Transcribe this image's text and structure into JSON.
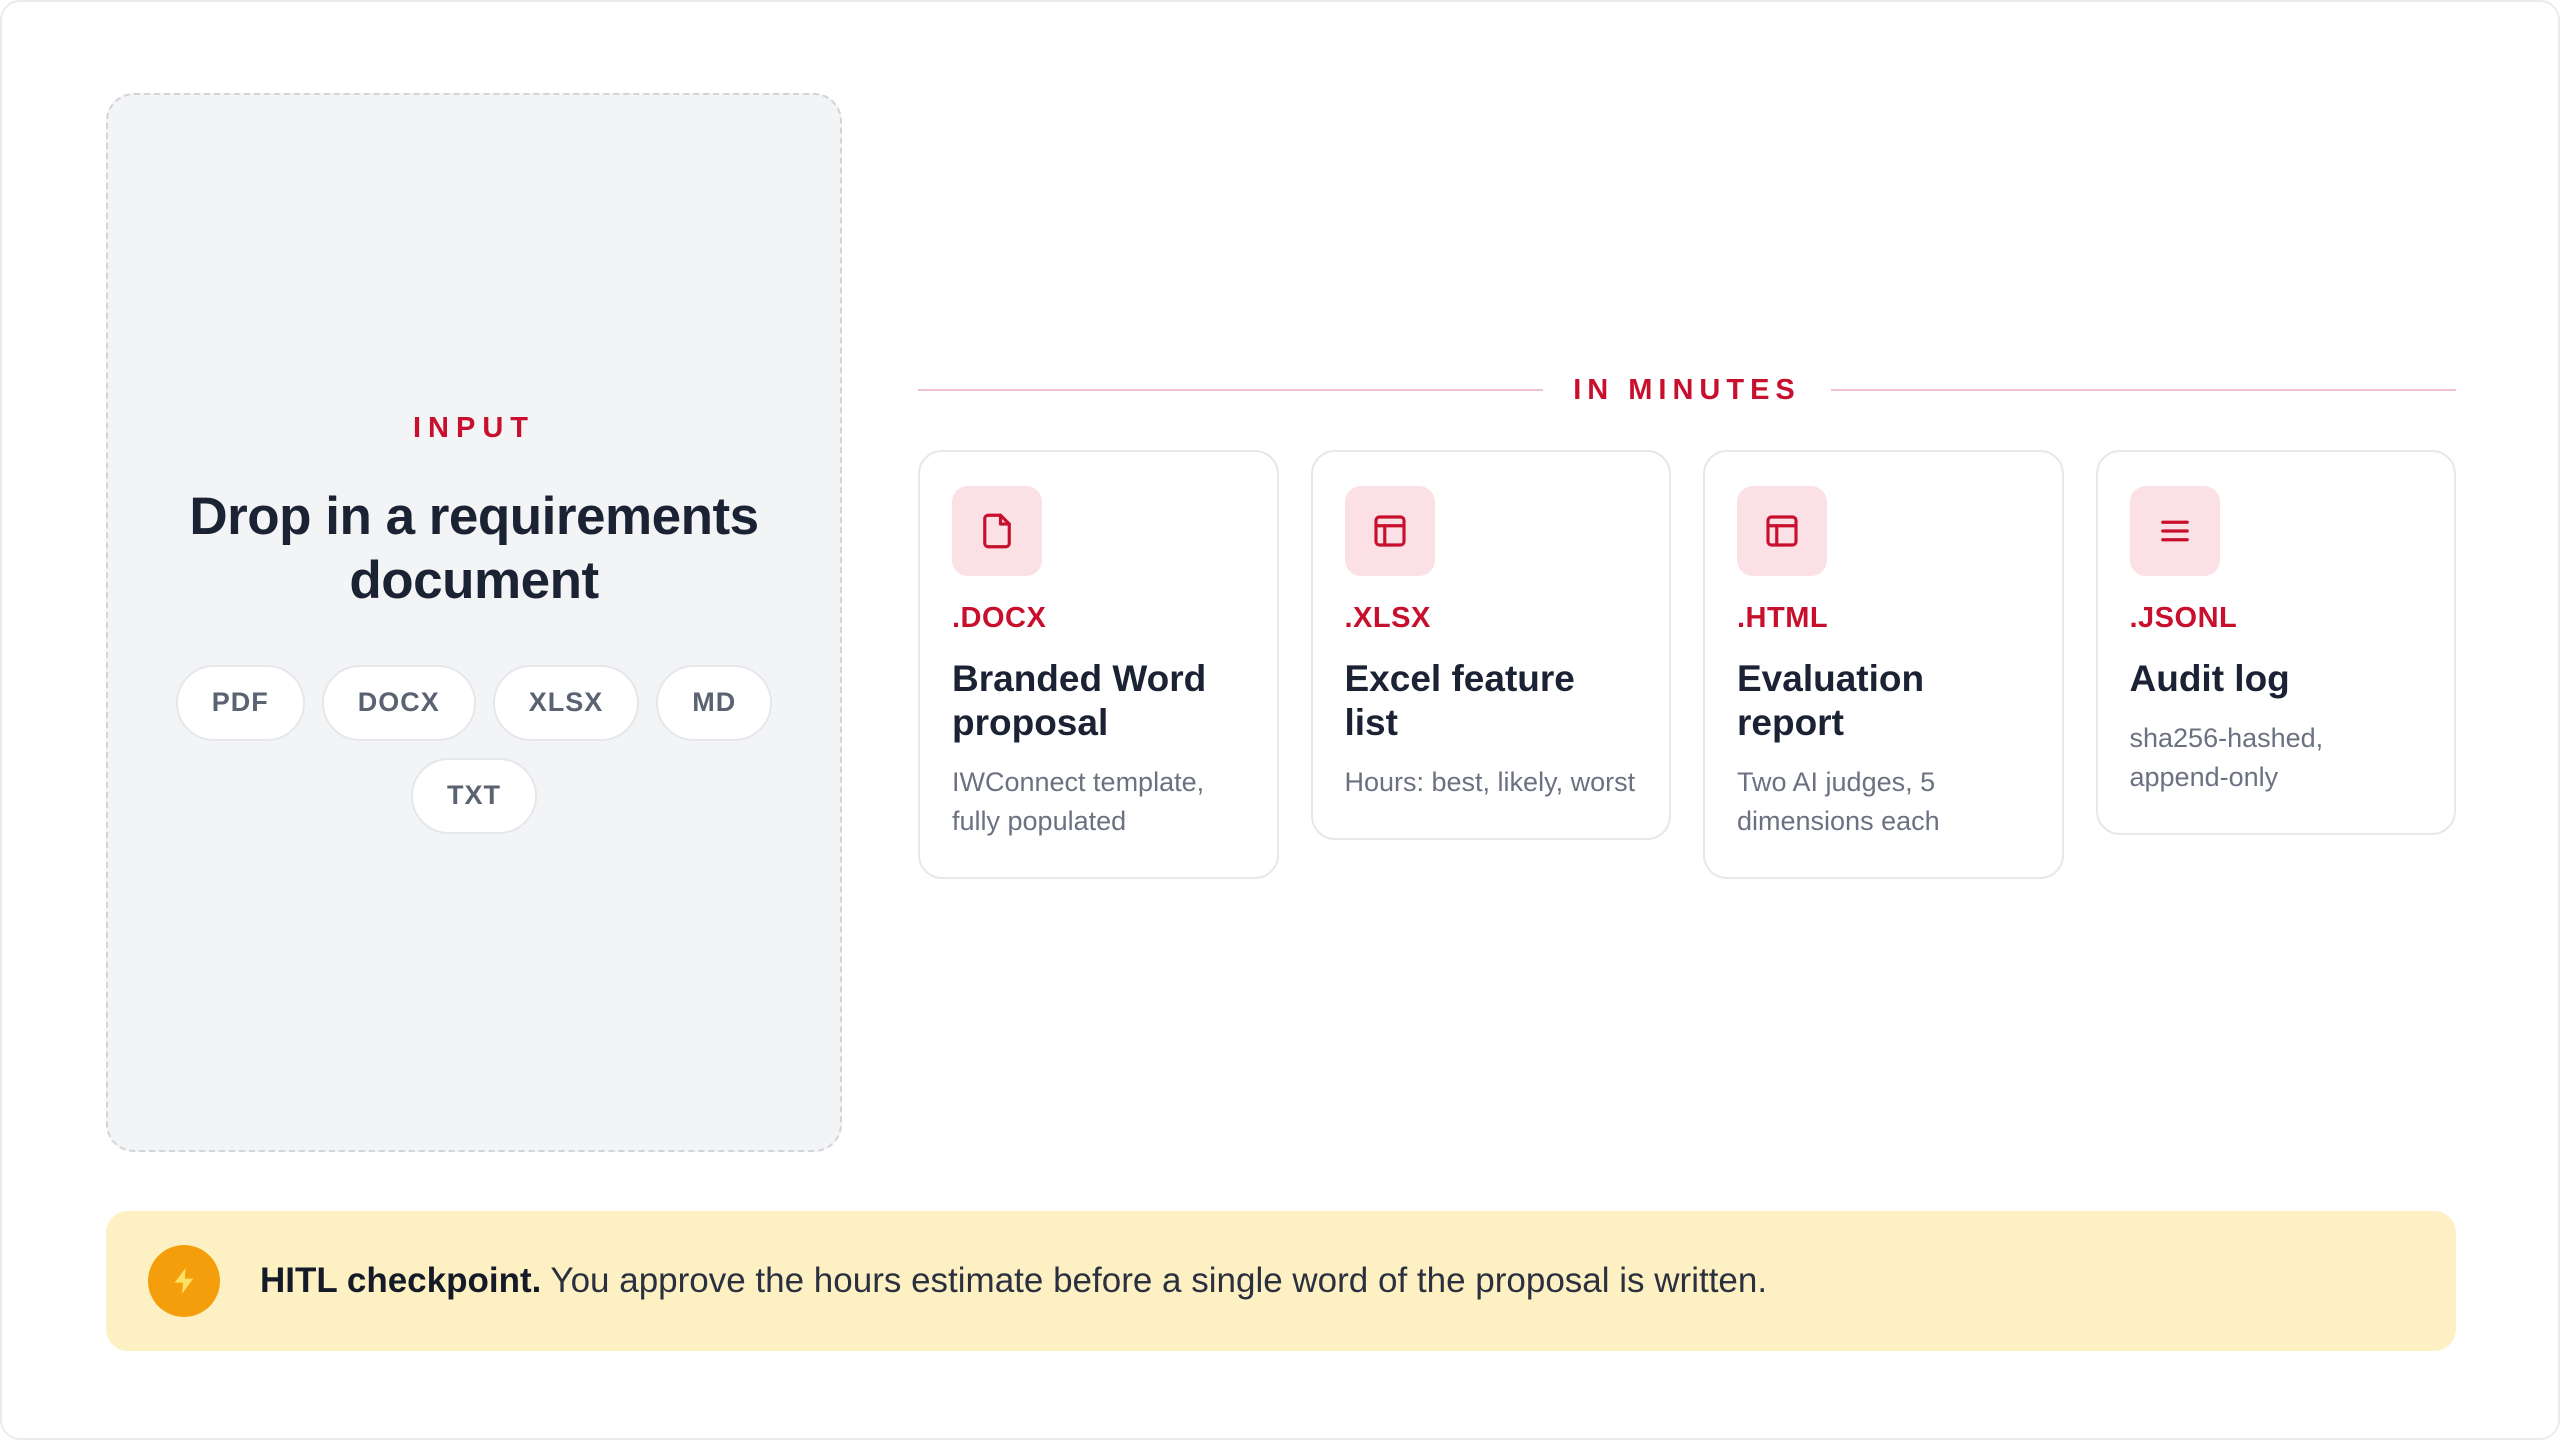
{
  "input": {
    "eyebrow": "INPUT",
    "title": "Drop in a requirements document",
    "formats": [
      "PDF",
      "DOCX",
      "XLSX",
      "MD",
      "TXT"
    ]
  },
  "output": {
    "eyebrow": "IN MINUTES",
    "cards": [
      {
        "icon": "file-icon",
        "ext": ".DOCX",
        "title": "Branded Word proposal",
        "desc": "IWConnect template, fully populated"
      },
      {
        "icon": "table-icon",
        "ext": ".XLSX",
        "title": "Excel feature list",
        "desc": "Hours: best, likely, worst"
      },
      {
        "icon": "layout-icon",
        "ext": ".HTML",
        "title": "Evaluation report",
        "desc": "Two AI judges, 5 dimensions each"
      },
      {
        "icon": "menu-lines-icon",
        "ext": ".JSONL",
        "title": "Audit log",
        "desc": "sha256-hashed, append-only"
      }
    ]
  },
  "banner": {
    "icon": "lightning-icon",
    "strong": "HITL checkpoint.",
    "text": " You approve the hours estimate before a single word of the proposal is written."
  },
  "colors": {
    "accent": "#c8102e",
    "icon_bg": "#fbe0e5",
    "banner_bg": "#fdf0c2",
    "bolt": "#f59e0b"
  }
}
